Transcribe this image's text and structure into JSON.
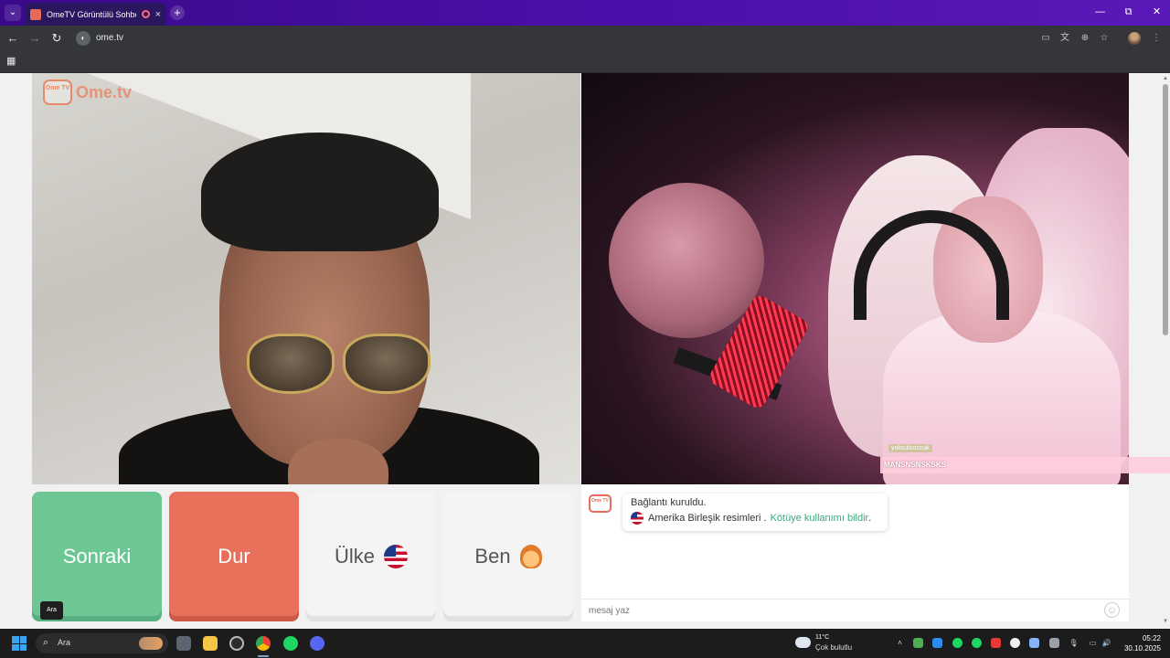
{
  "browser": {
    "tab_title": "OmeTV Görüntülü Sohbet - ",
    "tab_close": "×",
    "new_tab": "+",
    "url": "ome.tv",
    "window_controls": [
      "—",
      "⧉",
      "✕"
    ]
  },
  "page": {
    "logo": {
      "box": "Ome TV",
      "text": "Ome.tv"
    },
    "buttons": {
      "next": "Sonraki",
      "stop": "Dur",
      "country": "Ülke",
      "me": "Ben"
    },
    "tooltip": "Ara",
    "overlay": {
      "user_tag": "yoksulsozcuk",
      "message": "MANSNSNSKSKS"
    },
    "chat": {
      "logo": "Ome TV",
      "status": "Bağlantı kuruldu.",
      "country_line": "Amerika Birleşik resimleri .",
      "report_link": "Kötüye kullanımı bildir",
      "report_suffix": ".",
      "input_placeholder": "mesaj yaz"
    }
  },
  "taskbar": {
    "search_text": "Ara",
    "weather": {
      "temp": "11°C",
      "desc": "Çok bulutlu"
    },
    "clock": {
      "time": "05:22",
      "date": "30.10.2025"
    }
  }
}
